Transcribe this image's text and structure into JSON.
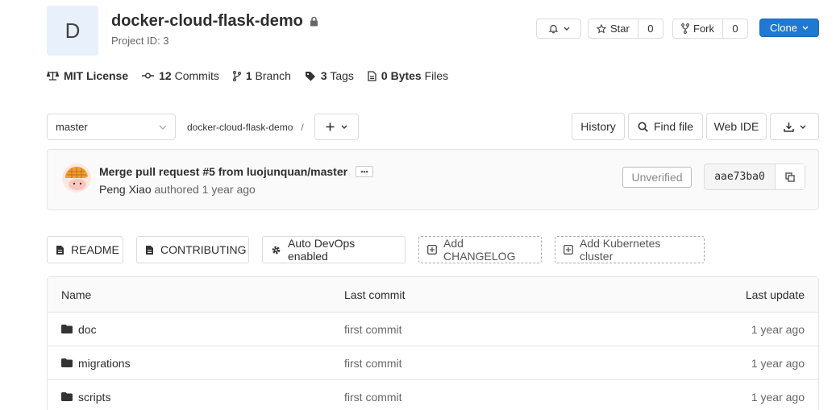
{
  "project": {
    "avatar_letter": "D",
    "name": "docker-cloud-flask-demo",
    "id_text": "Project ID: 3"
  },
  "header_actions": {
    "star_label": "Star",
    "star_count": "0",
    "fork_label": "Fork",
    "fork_count": "0",
    "clone_label": "Clone"
  },
  "stats": {
    "license": "MIT License",
    "commits_count": "12",
    "commits_label": "Commits",
    "branches_count": "1",
    "branches_label": "Branch",
    "tags_count": "3",
    "tags_label": "Tags",
    "files_size": "0 Bytes",
    "files_label": "Files"
  },
  "repo_nav": {
    "branch": "master",
    "breadcrumb_root": "docker-cloud-flask-demo",
    "breadcrumb_sep": "/",
    "history_label": "History",
    "find_file_label": "Find file",
    "web_ide_label": "Web IDE"
  },
  "last_commit": {
    "title": "Merge pull request #5 from luojunquan/master",
    "more": "•••",
    "author": "Peng Xiao",
    "authored_text": "authored",
    "time": "1 year ago",
    "status": "Unverified",
    "sha": "aae73ba0"
  },
  "quick_links": {
    "readme": "README",
    "contributing": "CONTRIBUTING",
    "autodevops": "Auto DevOps enabled",
    "add_changelog": "Add CHANGELOG",
    "add_k8s": "Add Kubernetes cluster"
  },
  "file_table": {
    "headers": {
      "name": "Name",
      "last_commit": "Last commit",
      "last_update": "Last update"
    },
    "rows": [
      {
        "name": "doc",
        "commit": "first commit",
        "updated": "1 year ago"
      },
      {
        "name": "migrations",
        "commit": "first commit",
        "updated": "1 year ago"
      },
      {
        "name": "scripts",
        "commit": "first commit",
        "updated": "1 year ago"
      }
    ]
  },
  "colors": {
    "primary": "#1f78d1",
    "avatar_bg": "#e8f1fb"
  }
}
